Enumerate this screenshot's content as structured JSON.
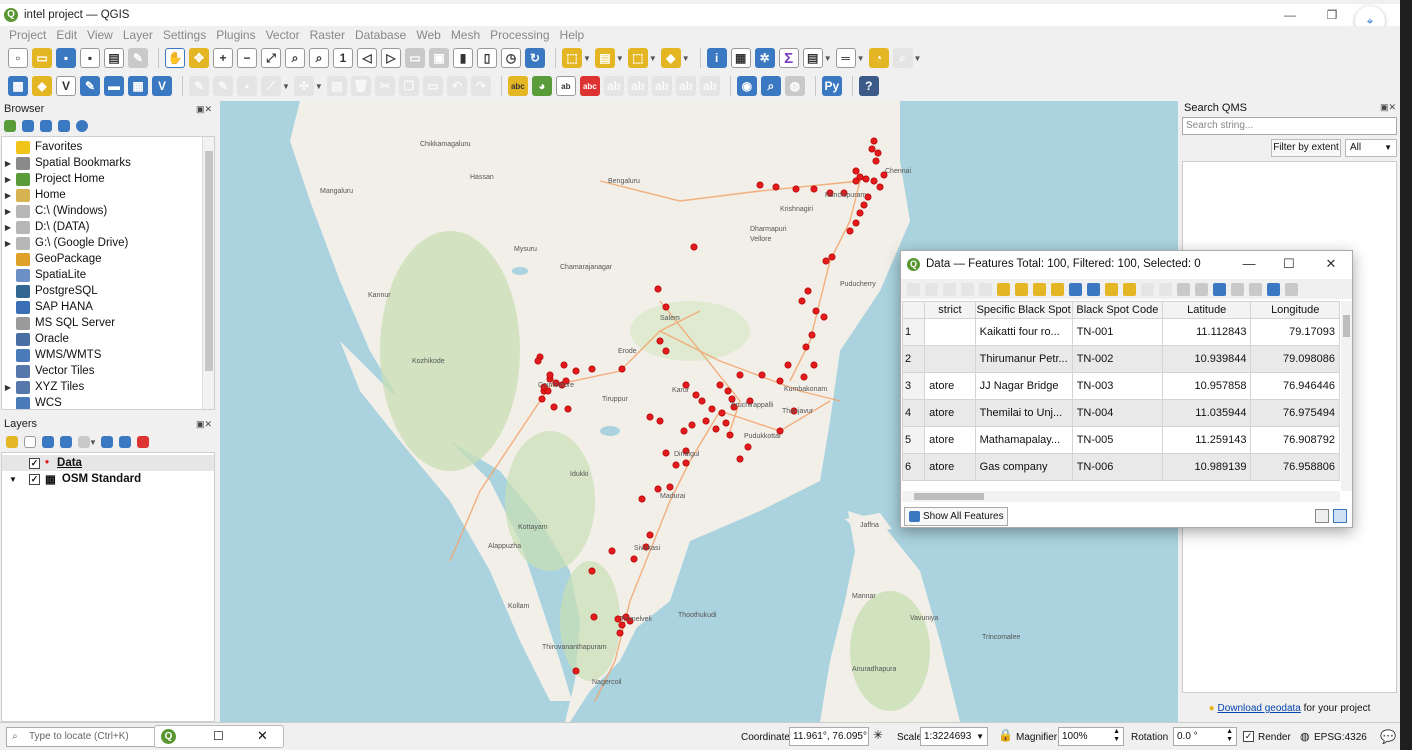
{
  "window": {
    "title": "intel project — QGIS",
    "minimize": "—",
    "maximize": "❐",
    "close": "✕"
  },
  "menu": [
    "Project",
    "Edit",
    "View",
    "Layer",
    "Settings",
    "Plugins",
    "Vector",
    "Raster",
    "Database",
    "Web",
    "Mesh",
    "Processing",
    "Help"
  ],
  "browser": {
    "title": "Browser",
    "items": [
      {
        "label": "Favorites",
        "icon": "star-icon",
        "color": "#f0c419",
        "expander": ""
      },
      {
        "label": "Spatial Bookmarks",
        "icon": "bookmark-icon",
        "color": "#8a8a8a",
        "expander": "▶"
      },
      {
        "label": "Project Home",
        "icon": "project-home-icon",
        "color": "#5a9b3a",
        "expander": "▶"
      },
      {
        "label": "Home",
        "icon": "folder-icon",
        "color": "#d7b352",
        "expander": "▶"
      },
      {
        "label": "C:\\ (Windows)",
        "icon": "drive-icon",
        "color": "#b7b7b7",
        "expander": "▶"
      },
      {
        "label": "D:\\ (DATA)",
        "icon": "drive-icon",
        "color": "#b7b7b7",
        "expander": "▶"
      },
      {
        "label": "G:\\ (Google Drive)",
        "icon": "drive-icon",
        "color": "#b7b7b7",
        "expander": "▶"
      },
      {
        "label": "GeoPackage",
        "icon": "geopackage-icon",
        "color": "#e0a12b",
        "expander": ""
      },
      {
        "label": "SpatiaLite",
        "icon": "spatialite-icon",
        "color": "#6c8fc5",
        "expander": ""
      },
      {
        "label": "PostgreSQL",
        "icon": "postgresql-icon",
        "color": "#336791",
        "expander": ""
      },
      {
        "label": "SAP HANA",
        "icon": "sap-hana-icon",
        "color": "#3a6fb5",
        "expander": ""
      },
      {
        "label": "MS SQL Server",
        "icon": "mssql-icon",
        "color": "#9a9a9a",
        "expander": ""
      },
      {
        "label": "Oracle",
        "icon": "oracle-icon",
        "color": "#4a6fa5",
        "expander": ""
      },
      {
        "label": "WMS/WMTS",
        "icon": "wms-icon",
        "color": "#4a7ab8",
        "expander": ""
      },
      {
        "label": "Vector Tiles",
        "icon": "vector-tiles-icon",
        "color": "#5577aa",
        "expander": ""
      },
      {
        "label": "XYZ Tiles",
        "icon": "xyz-tiles-icon",
        "color": "#5577aa",
        "expander": "▶"
      },
      {
        "label": "WCS",
        "icon": "wcs-icon",
        "color": "#4a7ab8",
        "expander": ""
      }
    ]
  },
  "layers": {
    "title": "Layers",
    "items": [
      {
        "label": "Data",
        "checked": "✓",
        "symbol": "•",
        "color": "#e41a1c"
      },
      {
        "label": "OSM Standard",
        "checked": "✓",
        "symbol": "▦",
        "color": "#333333"
      }
    ]
  },
  "map": {
    "labels": [
      "Chikkamagaluru",
      "Mangaluru",
      "Hassan",
      "Bengaluru",
      "Chennai",
      "Kanchipuram",
      "Mysuru",
      "Vellore",
      "Salem",
      "Kannur",
      "Kozhikode",
      "Erode",
      "Coimbatore",
      "Tiruppur",
      "Karur",
      "Tiruchirappalli",
      "Thanjavur",
      "Kumbakonam",
      "Pudukkottai",
      "Madurai",
      "Sivakasi",
      "Tirunelveli",
      "Thoothukudi",
      "Kollam",
      "Thiruvananthapuram",
      "Nagercoil",
      "Jaffna",
      "Puducherry",
      "Alappuzha",
      "Kottayam",
      "Mannar",
      "Vavuniya",
      "Trincomalee",
      "Anuradhapura",
      "Chamarajanagar",
      "Krishnagiri",
      "Dharmapuri",
      "Dindigul",
      "Idukki"
    ]
  },
  "qms": {
    "title": "Search QMS",
    "search_placeholder": "Search string...",
    "filter_button": "Filter by extent",
    "filter_select": "All",
    "download_link": "Download geodata",
    "download_suffix": " for your project"
  },
  "attr_table": {
    "title": "Data — Features Total: 100, Filtered: 100, Selected: 0",
    "columns": [
      "strict",
      "Specific Black Spot",
      "Black Spot Code",
      "Latitude",
      "Longitude"
    ],
    "rows": [
      {
        "n": "1",
        "district": "",
        "spot": "Kaikatti four ro...",
        "code": "TN-001",
        "lat": "11.112843",
        "lon": "79.17093"
      },
      {
        "n": "2",
        "district": "",
        "spot": "Thirumanur Petr...",
        "code": "TN-002",
        "lat": "10.939844",
        "lon": "79.098086"
      },
      {
        "n": "3",
        "district": "atore",
        "spot": "JJ Nagar Bridge",
        "code": "TN-003",
        "lat": "10.957858",
        "lon": "76.946446"
      },
      {
        "n": "4",
        "district": "atore",
        "spot": "Themilai to Unj...",
        "code": "TN-004",
        "lat": "11.035944",
        "lon": "76.975494"
      },
      {
        "n": "5",
        "district": "atore",
        "spot": "Mathamapalay...",
        "code": "TN-005",
        "lat": "11.259143",
        "lon": "76.908792"
      },
      {
        "n": "6",
        "district": "atore",
        "spot": "Gas company",
        "code": "TN-006",
        "lat": "10.989139",
        "lon": "76.958806"
      }
    ],
    "show_all": "Show All Features"
  },
  "status": {
    "locate_placeholder": "Type to locate (Ctrl+K)",
    "coordinate_label": "Coordinate",
    "coordinate_value": "11.961°, 76.095°",
    "scale_label": "Scale",
    "scale_value": "1:3224693",
    "magnifier_label": "Magnifier",
    "magnifier_value": "100%",
    "rotation_label": "Rotation",
    "rotation_value": "0.0 °",
    "render_label": "Render",
    "epsg": "EPSG:4326"
  }
}
